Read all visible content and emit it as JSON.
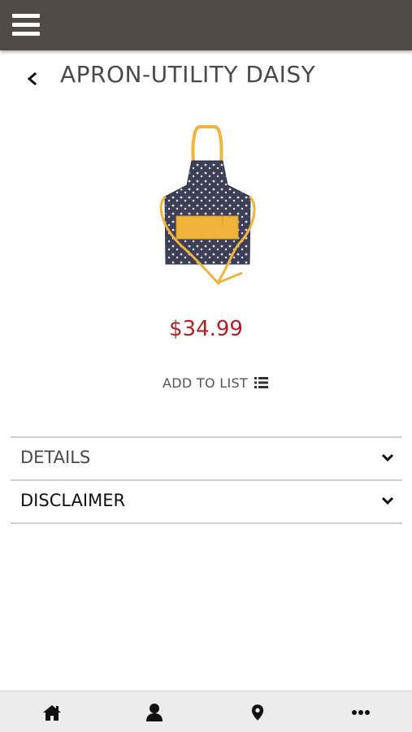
{
  "header": {
    "menu_icon": "hamburger-icon"
  },
  "product": {
    "title": "APRON-UTILITY DAISY",
    "price": "$34.99",
    "add_to_list_label": "ADD TO LIST",
    "image_alt": "apron"
  },
  "sections": [
    {
      "label": "DETAILS"
    },
    {
      "label": "DISCLAIMER"
    }
  ],
  "bottom_nav": [
    {
      "icon": "home-icon"
    },
    {
      "icon": "user-icon"
    },
    {
      "icon": "location-pin-icon"
    },
    {
      "icon": "more-icon"
    }
  ],
  "colors": {
    "topbar": "#4f4a45",
    "price": "#b81f25",
    "apron_fabric": "#3c3f57",
    "apron_trim": "#f0b33c"
  }
}
